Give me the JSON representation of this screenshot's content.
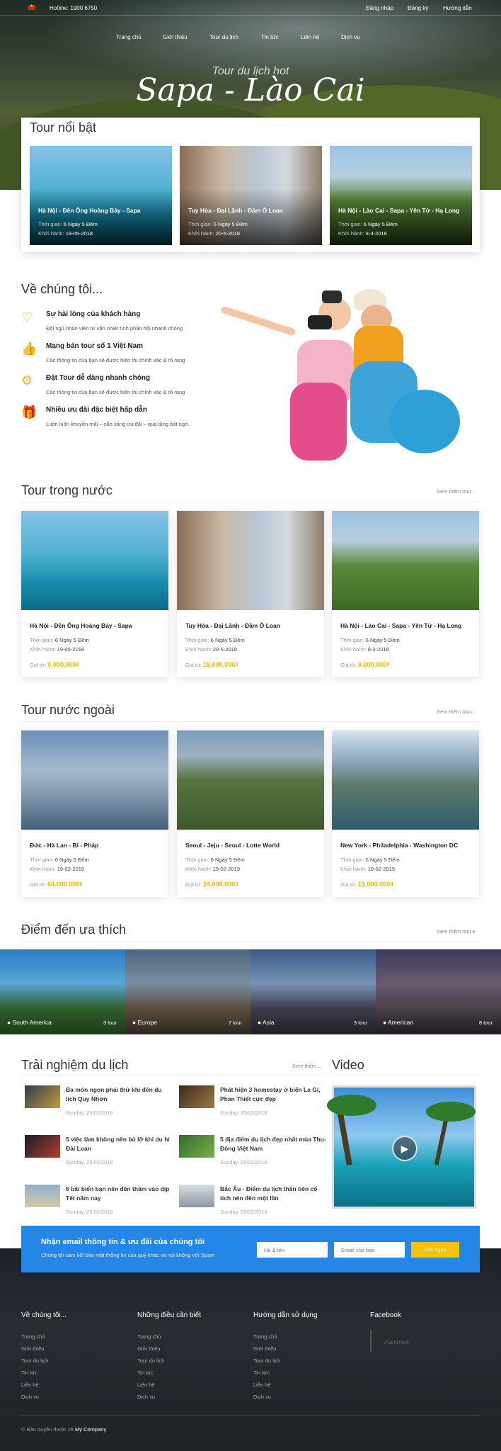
{
  "topbar": {
    "hotline": "Hotline: 1900 6750",
    "login": "Đăng nhập",
    "register": "Đăng ký",
    "guide": "Hướng dẫn"
  },
  "nav": [
    "Trang chủ",
    "Giới thiệu",
    "Tour du lịch",
    "Tin tức",
    "Liên hệ",
    "Dịch vụ"
  ],
  "hero": {
    "subtitle": "Tour du lịch hot",
    "title": "Sapa - Lào Cai"
  },
  "featured": {
    "title": "Tour nổi bật",
    "items": [
      {
        "name": "Hà Nội - Đền Ông Hoàng Bảy - Sapa",
        "time_label": "Thời gian:",
        "time": "6 Ngày 5 Đêm",
        "depart_label": "Khởi hành:",
        "depart": "19-05-2018"
      },
      {
        "name": "Tuy Hòa - Đại Lãnh - Đầm Ô Loan",
        "time_label": "Thời gian:",
        "time": "6 Ngày 5 Đêm",
        "depart_label": "Khởi hành:",
        "depart": "20-5-2018"
      },
      {
        "name": "Hà Nội - Lào Cai - Sapa - Yên Tử - Hạ Long",
        "time_label": "Thời gian:",
        "time": "6 Ngày 5 Đêm",
        "depart_label": "Khởi hành:",
        "depart": "8-3-2018"
      }
    ]
  },
  "about": {
    "title": "Về chúng tôi...",
    "features": [
      {
        "icon": "heart-icon",
        "title": "Sự hài lòng của khách hàng",
        "text": "Đội ngũ nhân viên tư vấn nhiệt tình phản hồi nhanh chóng"
      },
      {
        "icon": "thumbs-up-icon",
        "title": "Mạng bán tour số 1 Việt Nam",
        "text": "Các thông tin của bạn sẽ được hiển thị chính xác & rõ ràng"
      },
      {
        "icon": "gear-icon",
        "title": "Đặt Tour dễ dàng nhanh chóng",
        "text": "Các thông tin của bạn sẽ được hiển thị chính xác & rõ ràng"
      },
      {
        "icon": "gift-icon",
        "title": "Nhiều ưu đãi đặc biệt hấp dẫn",
        "text": "Luôn luôn khuyến mãi – sẵn sàng ưu đãi – quà tặng bất ngờ."
      }
    ]
  },
  "domestic": {
    "title": "Tour trong nước",
    "more": "Xem thêm tour...",
    "items": [
      {
        "name": "Hà Nội - Đền Ông Hoàng Bảy - Sapa",
        "time_label": "Thời gian:",
        "time": "6 Ngày 5 Đêm",
        "depart_label": "Khởi hành:",
        "depart": "19-05-2018",
        "price_label": "Giá từ:",
        "price": "9.000.000₫"
      },
      {
        "name": "Tuy Hòa - Đại Lãnh - Đầm Ô Loan",
        "time_label": "Thời gian:",
        "time": "6 Ngày 5 Đêm",
        "depart_label": "Khởi hành:",
        "depart": "20-5-2018",
        "price_label": "Giá từ:",
        "price": "18.000.000₫"
      },
      {
        "name": "Hà Nội - Lào Cai - Sapa - Yên Tử - Hạ Long",
        "time_label": "Thời gian:",
        "time": "6 Ngày 5 Đêm",
        "depart_label": "Khởi hành:",
        "depart": "8-3-2018",
        "price_label": "Giá từ:",
        "price": "8.000.000₫"
      }
    ]
  },
  "foreign": {
    "title": "Tour nước ngoài",
    "more": "Xem thêm tour...",
    "items": [
      {
        "name": "Đức - Hà Lan - Bỉ - Pháp",
        "time_label": "Thời gian:",
        "time": "6 Ngày 5 Đêm",
        "depart_label": "Khởi hành:",
        "depart": "19-02-2019",
        "price_label": "Giá từ:",
        "price": "64.000.000₫"
      },
      {
        "name": "Seoul - Jeju - Seoul - Lotte World",
        "time_label": "Thời gian:",
        "time": "6 Ngày 5 Đêm",
        "depart_label": "Khởi hành:",
        "depart": "19-02-2019",
        "price_label": "Giá từ:",
        "price": "24.000.000₫"
      },
      {
        "name": "New York - Philadelphia - Washington DC",
        "time_label": "Thời gian:",
        "time": "6 Ngày 5 Đêm",
        "depart_label": "Khởi hành:",
        "depart": "19-02-2019",
        "price_label": "Giá từ:",
        "price": "15.000.000₫"
      }
    ]
  },
  "destinations": {
    "title": "Điểm đến ưa thích",
    "more": "Xem thêm tour ▸",
    "items": [
      {
        "name": "South America",
        "count": "3 tour"
      },
      {
        "name": "Europe",
        "count": "7 tour"
      },
      {
        "name": "Asia",
        "count": "3 tour"
      },
      {
        "name": "American",
        "count": "8 tour"
      }
    ]
  },
  "experience": {
    "title": "Trải nghiệm du lịch",
    "more": "Xem thêm...",
    "items": [
      {
        "title": "Ba món ngon phải thử khi đến du lịch Quy Nhơn",
        "date": "Sunday, 25/02/2018"
      },
      {
        "title": "Phát hiện 3 homestay ở biển La Gi, Phan Thiết cực đẹp",
        "date": "Sunday, 25/02/2018"
      },
      {
        "title": "5 việc làm không nên bỏ lỡ khi du hí Đài Loan",
        "date": "Sunday, 25/02/2018"
      },
      {
        "title": "5 địa điểm du lịch đẹp nhất mùa Thu-Đông Việt Nam",
        "date": "Sunday, 25/02/2018"
      },
      {
        "title": "6 bãi biển bạn nên đến thăm vào dịp Tết năm nay",
        "date": "Sunday, 25/02/2018"
      },
      {
        "title": "Bắc Âu - Điểm du lịch thần tiên cổ tích nên đến một lần",
        "date": "Sunday, 25/02/2018"
      }
    ]
  },
  "video": {
    "title": "Video"
  },
  "newsletter": {
    "title": "Nhận email thông tin & ưu đãi của chúng tôi",
    "text": "Chúng tôi cam kết bảo mật thông tin của quý khác và nói không với Spam",
    "name_placeholder": "Họ & tên",
    "email_placeholder": "Email của bạn",
    "button": "Gửi ngay"
  },
  "footer": {
    "cols": [
      {
        "title": "Về chúng tôi...",
        "links": [
          "Trang chủ",
          "Giới thiệu",
          "Tour du lịch",
          "Tin tức",
          "Liên hệ",
          "Dịch vụ"
        ]
      },
      {
        "title": "Những điều cần biết",
        "links": [
          "Trang chủ",
          "Giới thiệu",
          "Tour du lịch",
          "Tin tức",
          "Liên hệ",
          "Dịch vụ"
        ]
      },
      {
        "title": "Hướng dẫn sử dụng",
        "links": [
          "Trang chủ",
          "Giới thiệu",
          "Tour du lịch",
          "Tin tức",
          "Liên hệ",
          "Dịch vụ"
        ]
      }
    ],
    "facebook": {
      "title": "Facebook",
      "placeholder": "Facebook"
    },
    "copyright": "© Bản quyền thuộc về",
    "company": "My Company"
  },
  "colors": {
    "accent": "#f5b800",
    "newsletter_bg": "#2486e6",
    "footer_bg": "#1f2227"
  }
}
